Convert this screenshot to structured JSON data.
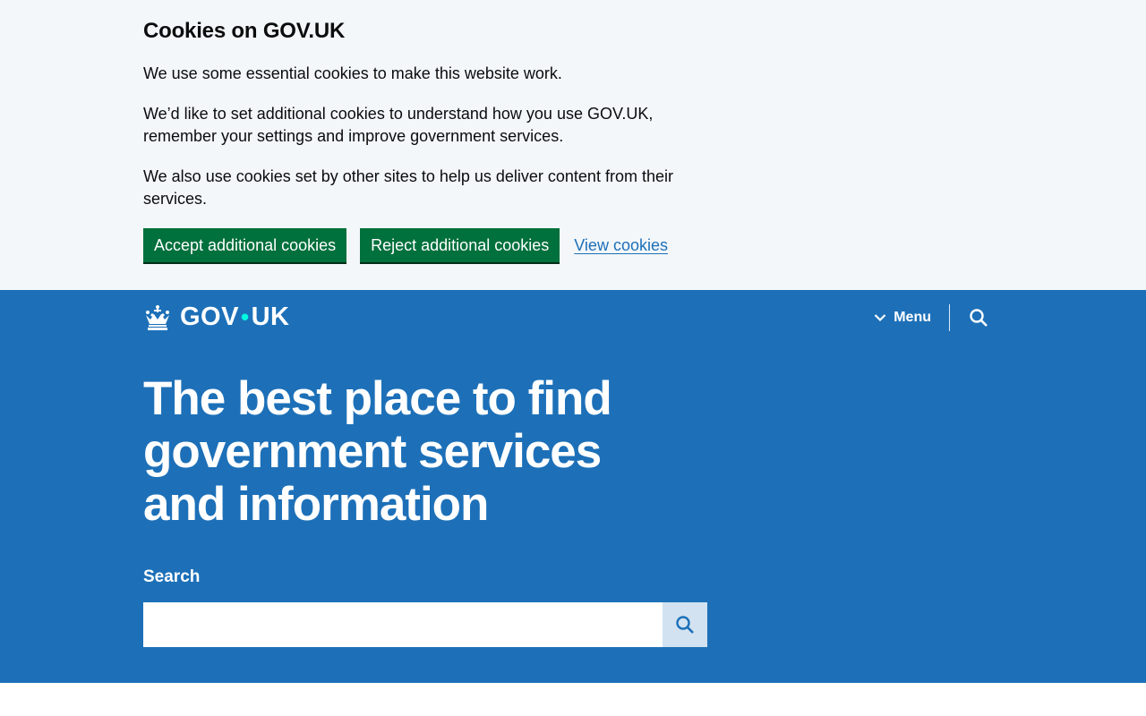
{
  "cookie_banner": {
    "title": "Cookies on GOV.UK",
    "paragraph_1": "We use some essential cookies to make this website work.",
    "paragraph_2": "We’d like to set additional cookies to understand how you use GOV.UK, remember your settings and improve government services.",
    "paragraph_3": "We also use cookies set by other sites to help us deliver content from their services.",
    "accept_label": "Accept additional cookies",
    "reject_label": "Reject additional cookies",
    "view_label": "View cookies"
  },
  "header": {
    "logo_left": "GOV",
    "logo_dot": "•",
    "logo_right": "UK",
    "menu_label": "Menu",
    "search_icon": "search-icon",
    "crown_icon": "crown-icon"
  },
  "hero": {
    "title": "The best place to find government services and information",
    "search_label": "Search",
    "search_value": "",
    "search_placeholder": ""
  },
  "colors": {
    "brand_blue": "#1d70b8",
    "banner_bg": "#f3f7fa",
    "button_green": "#00703c",
    "search_button_bg": "#d2e2f1",
    "logo_dot": "#00ffe0"
  }
}
